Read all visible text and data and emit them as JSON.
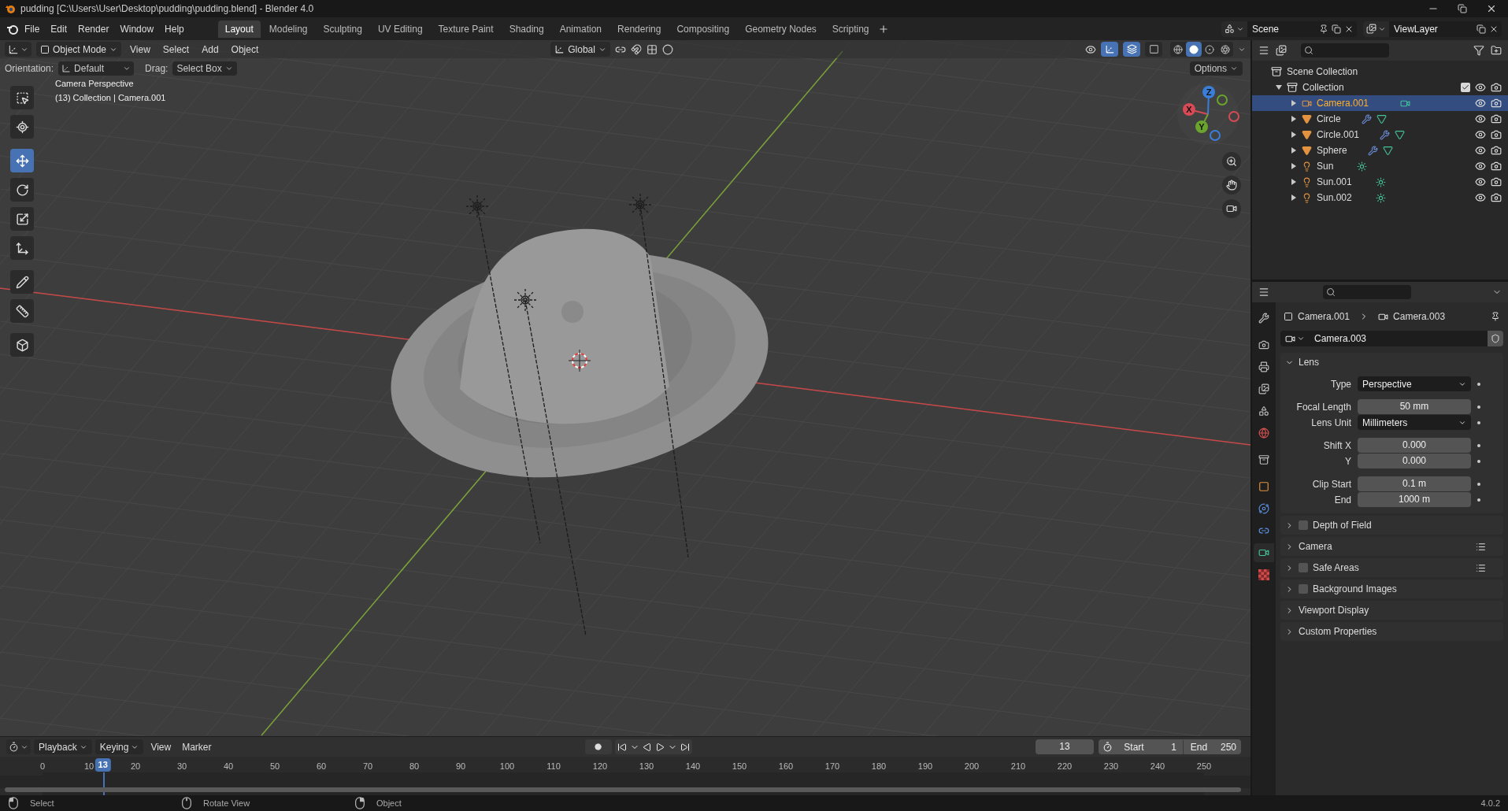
{
  "title_bar": {
    "title": "pudding [C:\\Users\\User\\Desktop\\pudding\\pudding.blend] - Blender 4.0"
  },
  "menu": [
    "File",
    "Edit",
    "Render",
    "Window",
    "Help"
  ],
  "workspaces": [
    {
      "label": "Layout",
      "selected": true
    },
    {
      "label": "Modeling",
      "selected": false
    },
    {
      "label": "Sculpting",
      "selected": false
    },
    {
      "label": "UV Editing",
      "selected": false
    },
    {
      "label": "Texture Paint",
      "selected": false
    },
    {
      "label": "Shading",
      "selected": false
    },
    {
      "label": "Animation",
      "selected": false
    },
    {
      "label": "Rendering",
      "selected": false
    },
    {
      "label": "Compositing",
      "selected": false
    },
    {
      "label": "Geometry Nodes",
      "selected": false
    },
    {
      "label": "Scripting",
      "selected": false
    }
  ],
  "scene": "Scene",
  "view_layer": "ViewLayer",
  "viewport": {
    "mode": "Object Mode",
    "menus": [
      "View",
      "Select",
      "Add",
      "Object"
    ],
    "transform_orientation": "Global",
    "toggles": [
      {
        "kind": "gizmo",
        "on": true
      },
      {
        "kind": "overlay",
        "on": true
      },
      {
        "kind": "xray",
        "on": false
      }
    ],
    "shading": [
      {
        "kind": "wireframe",
        "selected": false
      },
      {
        "kind": "solid",
        "selected": true
      },
      {
        "kind": "material",
        "selected": false
      },
      {
        "kind": "rendered",
        "selected": false
      }
    ],
    "orientation_label": "Orientation:",
    "orientation": "Default",
    "drag_label": "Drag:",
    "drag": "Select Box",
    "options": "Options",
    "overlay_text": [
      "Camera Perspective",
      "(13) Collection | Camera.001"
    ],
    "tools": [
      {
        "kind": "select",
        "selected": false
      },
      {
        "kind": "cursor",
        "selected": false
      },
      {
        "kind": "move",
        "selected": true
      },
      {
        "kind": "rotate",
        "selected": false
      },
      {
        "kind": "scale",
        "selected": false
      },
      {
        "kind": "transform",
        "selected": false
      },
      {
        "kind": "annotate",
        "selected": false
      },
      {
        "kind": "measure",
        "selected": false
      },
      {
        "kind": "add_cube",
        "selected": false
      }
    ],
    "gizmo_axes": [
      "X",
      "Y",
      "Z"
    ]
  },
  "outliner": {
    "root": "Scene Collection",
    "collection": {
      "name": "Collection",
      "expanded": true,
      "checked": true,
      "children": [
        {
          "name": "Camera.001",
          "kind": "camera",
          "selected": true,
          "expanded": false
        },
        {
          "name": "Circle",
          "kind": "mesh",
          "selected": false,
          "expanded": false
        },
        {
          "name": "Circle.001",
          "kind": "mesh",
          "selected": false,
          "expanded": false
        },
        {
          "name": "Sphere",
          "kind": "mesh",
          "selected": false,
          "expanded": false
        },
        {
          "name": "Sun",
          "kind": "light",
          "selected": false,
          "expanded": false
        },
        {
          "name": "Sun.001",
          "kind": "light",
          "selected": false,
          "expanded": false
        },
        {
          "name": "Sun.002",
          "kind": "light",
          "selected": false,
          "expanded": false
        }
      ]
    }
  },
  "properties": {
    "tabs": [
      {
        "kind": "tool",
        "selected": false
      },
      {
        "kind": "render",
        "selected": false
      },
      {
        "kind": "output",
        "selected": false
      },
      {
        "kind": "view_layer",
        "selected": false
      },
      {
        "kind": "scene",
        "selected": false
      },
      {
        "kind": "world",
        "selected": false
      },
      {
        "kind": "collection",
        "selected": false
      },
      {
        "kind": "object",
        "selected": false
      },
      {
        "kind": "physics",
        "selected": false
      },
      {
        "kind": "constraints",
        "selected": false
      },
      {
        "kind": "camera",
        "selected": true
      },
      {
        "kind": "texture",
        "selected": false
      }
    ],
    "breadcrumb": [
      "Camera.001",
      "Camera.003"
    ],
    "datablock": "Camera.003",
    "panels": [
      {
        "title": "Lens",
        "expanded": true,
        "kind": "plain",
        "presets": false,
        "groups": [
          [
            {
              "label": "Type",
              "value": "Perspective",
              "kind": "dropdown"
            }
          ],
          [
            {
              "label": "Focal Length",
              "value": "50 mm",
              "kind": "number"
            },
            {
              "label": "Lens Unit",
              "value": "Millimeters",
              "kind": "dropdown"
            }
          ],
          [
            {
              "label": "Shift X",
              "value": "0.000",
              "kind": "number"
            },
            {
              "label": "Y",
              "value": "0.000",
              "kind": "number"
            }
          ],
          [
            {
              "label": "Clip Start",
              "value": "0.1 m",
              "kind": "number"
            },
            {
              "label": "End",
              "value": "1000 m",
              "kind": "number"
            }
          ]
        ]
      },
      {
        "title": "Depth of Field",
        "expanded": false,
        "kind": "toggle",
        "checked": false,
        "presets": false
      },
      {
        "title": "Camera",
        "expanded": false,
        "kind": "plain",
        "presets": true
      },
      {
        "title": "Safe Areas",
        "expanded": false,
        "kind": "toggle",
        "checked": false,
        "presets": true
      },
      {
        "title": "Background Images",
        "expanded": false,
        "kind": "toggle",
        "checked": false,
        "presets": false
      },
      {
        "title": "Viewport Display",
        "expanded": false,
        "kind": "plain",
        "presets": false
      },
      {
        "title": "Custom Properties",
        "expanded": false,
        "kind": "plain",
        "presets": false
      }
    ]
  },
  "timeline": {
    "menus": [
      "Playback",
      "Keying",
      "View",
      "Marker"
    ],
    "current_frame": "13",
    "start_label": "Start",
    "start": "1",
    "end_label": "End",
    "end": "250",
    "ticks": [
      "0",
      "10",
      "20",
      "30",
      "40",
      "50",
      "60",
      "70",
      "80",
      "90",
      "100",
      "110",
      "120",
      "130",
      "140",
      "150",
      "160",
      "170",
      "180",
      "190",
      "200",
      "210",
      "220",
      "230",
      "240",
      "250"
    ],
    "playhead": {
      "label": "13",
      "level": 0.052
    }
  },
  "status_bar": {
    "hints": [
      {
        "kind": "left",
        "label": "Select"
      },
      {
        "kind": "middle",
        "label": "Rotate View"
      },
      {
        "kind": "right",
        "label": "Object"
      }
    ],
    "version": "4.0.2"
  }
}
